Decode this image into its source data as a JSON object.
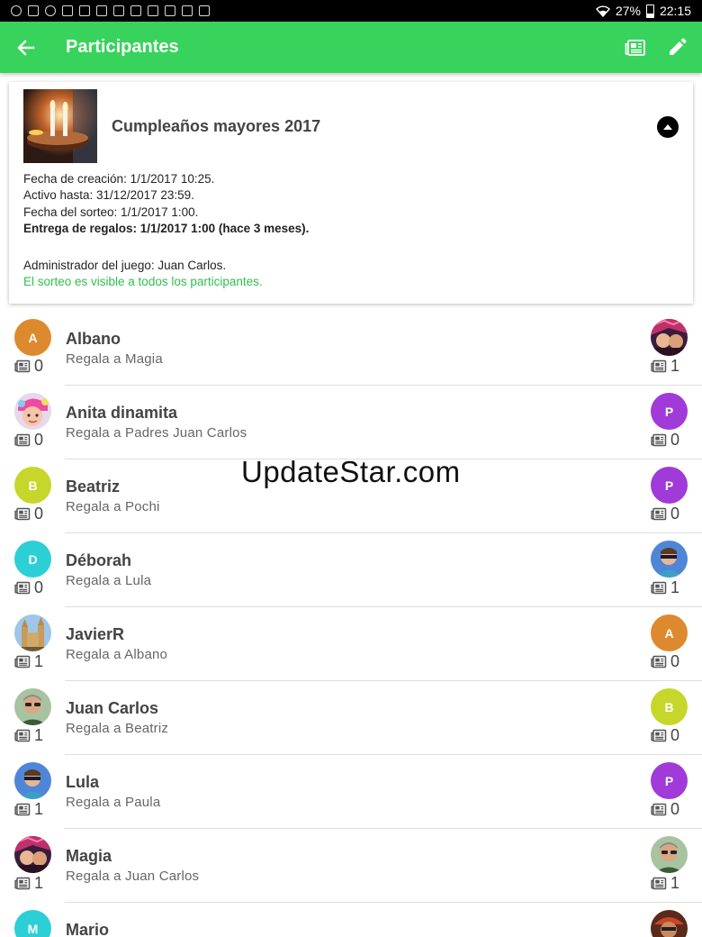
{
  "status_bar": {
    "battery": "27%",
    "time": "22:15"
  },
  "app_bar": {
    "title": "Participantes"
  },
  "event": {
    "title": "Cumpleaños mayores 2017",
    "created": "Fecha de creación: 1/1/2017 10:25.",
    "active_until": "Activo hasta: 31/12/2017 23:59.",
    "draw_date": "Fecha del sorteo: 1/1/2017 1:00.",
    "gift_delivery": "Entrega de regalos: 1/1/2017 1:00 (hace 3 meses).",
    "admin": "Administrador del juego: Juan Carlos.",
    "visibility": "El sorteo es visible a todos los participantes."
  },
  "watermark": "UpdateStar.com",
  "participants": [
    {
      "name": "Albano",
      "gives_to": "Regala a Magia",
      "left_count": "0",
      "right_count": "1",
      "left_avatar": {
        "letter": "A",
        "color": "#dd8a2e"
      },
      "right_avatar": {
        "photo": "magia"
      }
    },
    {
      "name": "Anita dinamita",
      "gives_to": "Regala a Padres Juan Carlos",
      "left_count": "0",
      "right_count": "0",
      "left_avatar": {
        "photo": "anita"
      },
      "right_avatar": {
        "letter": "P",
        "color": "#a03ad8"
      }
    },
    {
      "name": "Beatriz",
      "gives_to": "Regala a Pochi",
      "left_count": "0",
      "right_count": "0",
      "left_avatar": {
        "letter": "B",
        "color": "#c7d62a"
      },
      "right_avatar": {
        "letter": "P",
        "color": "#a03ad8"
      }
    },
    {
      "name": "Déborah",
      "gives_to": "Regala a Lula",
      "left_count": "0",
      "right_count": "1",
      "left_avatar": {
        "letter": "D",
        "color": "#2dcfd6"
      },
      "right_avatar": {
        "photo": "lula"
      }
    },
    {
      "name": "JavierR",
      "gives_to": "Regala a Albano",
      "left_count": "1",
      "right_count": "0",
      "left_avatar": {
        "photo": "javier"
      },
      "right_avatar": {
        "letter": "A",
        "color": "#dd8a2e"
      }
    },
    {
      "name": "Juan Carlos",
      "gives_to": "Regala a Beatriz",
      "left_count": "1",
      "right_count": "0",
      "left_avatar": {
        "photo": "juancarlos"
      },
      "right_avatar": {
        "letter": "B",
        "color": "#c7d62a"
      }
    },
    {
      "name": "Lula",
      "gives_to": "Regala a Paula",
      "left_count": "1",
      "right_count": "0",
      "left_avatar": {
        "photo": "lula"
      },
      "right_avatar": {
        "letter": "P",
        "color": "#a03ad8"
      }
    },
    {
      "name": "Magia",
      "gives_to": "Regala a Juan Carlos",
      "left_count": "1",
      "right_count": "1",
      "left_avatar": {
        "photo": "magia"
      },
      "right_avatar": {
        "photo": "juancarlos"
      }
    },
    {
      "name": "Mario",
      "gives_to": "",
      "left_count": "",
      "right_count": "",
      "left_avatar": {
        "letter": "M",
        "color": "#2dcfd6"
      },
      "right_avatar": {
        "photo": "mario"
      }
    }
  ]
}
